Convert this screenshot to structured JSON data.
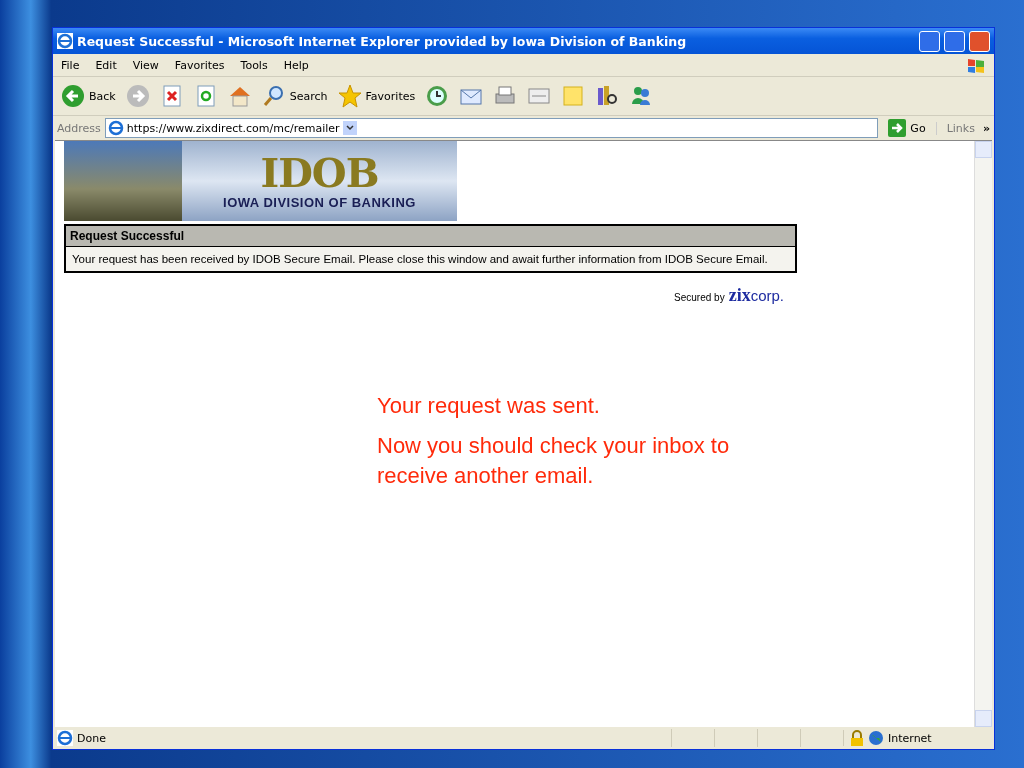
{
  "window": {
    "title": "Request Successful - Microsoft Internet Explorer provided by Iowa Division of Banking"
  },
  "menu": [
    "File",
    "Edit",
    "View",
    "Favorites",
    "Tools",
    "Help"
  ],
  "toolbar": [
    {
      "kind": "back",
      "label": "Back"
    },
    {
      "kind": "forward"
    },
    {
      "kind": "stop"
    },
    {
      "kind": "refresh"
    },
    {
      "kind": "home"
    },
    {
      "kind": "search",
      "label": "Search"
    },
    {
      "kind": "favorites",
      "label": "Favorites"
    },
    {
      "kind": "history"
    },
    {
      "kind": "mail"
    },
    {
      "kind": "print"
    },
    {
      "kind": "edit"
    },
    {
      "kind": "note"
    },
    {
      "kind": "research"
    },
    {
      "kind": "messenger"
    }
  ],
  "address": {
    "label": "Address",
    "value": "https://www.zixdirect.com/mc/remailer",
    "go": "Go",
    "links": "Links",
    "more": "»"
  },
  "page": {
    "banner": {
      "letters": "IDOB",
      "name": "IOWA DIVISION OF BANKING"
    },
    "panel": {
      "heading": "Request Successful",
      "body": "Your request has been received by IDOB Secure Email. Please close this window and await further information from IDOB Secure Email."
    },
    "secured": {
      "label": "Secured by",
      "brand": "zix",
      "suffix": "corp."
    }
  },
  "annotation": [
    "Your request was sent.",
    "Now you should check your inbox to receive another email."
  ],
  "status_bar": {
    "text": "Done",
    "zone": "Internet"
  }
}
